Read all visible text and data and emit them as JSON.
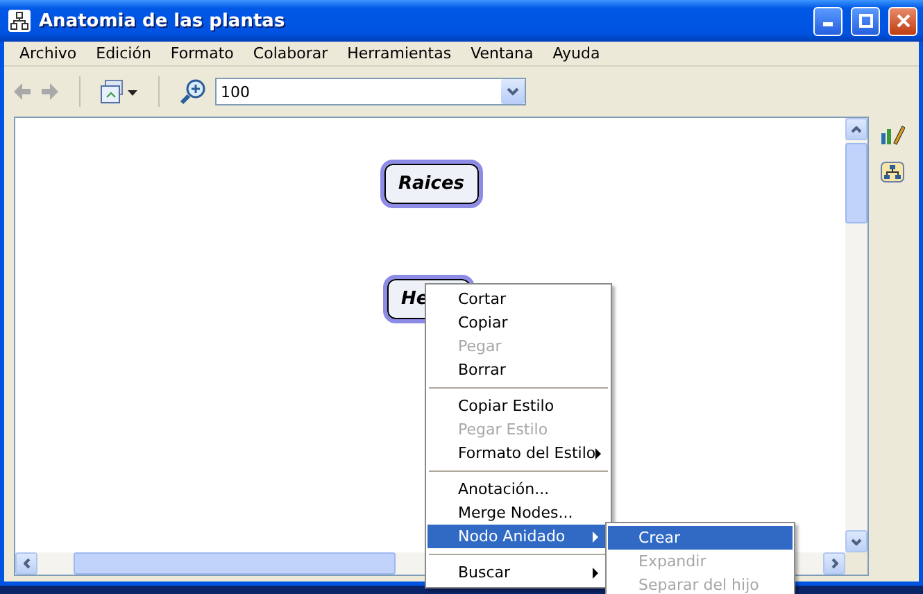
{
  "window": {
    "title": "Anatomia de las plantas"
  },
  "menu_bar": [
    "Archivo",
    "Edición",
    "Formato",
    "Colaborar",
    "Herramientas",
    "Ventana",
    "Ayuda"
  ],
  "toolbar": {
    "zoom_value": "100"
  },
  "nodes": [
    {
      "label": "Raices"
    },
    {
      "label": "He"
    }
  ],
  "context_menu": [
    {
      "kind": "item",
      "label": "Cortar",
      "disabled": false,
      "selected": false,
      "submenu": false
    },
    {
      "kind": "item",
      "label": "Copiar",
      "disabled": false,
      "selected": false,
      "submenu": false
    },
    {
      "kind": "item",
      "label": "Pegar",
      "disabled": true,
      "selected": false,
      "submenu": false
    },
    {
      "kind": "item",
      "label": "Borrar",
      "disabled": false,
      "selected": false,
      "submenu": false
    },
    {
      "kind": "separator"
    },
    {
      "kind": "item",
      "label": "Copiar Estilo",
      "disabled": false,
      "selected": false,
      "submenu": false
    },
    {
      "kind": "item",
      "label": "Pegar Estilo",
      "disabled": true,
      "selected": false,
      "submenu": false
    },
    {
      "kind": "item",
      "label": "Formato del Estilo",
      "disabled": false,
      "selected": false,
      "submenu": true
    },
    {
      "kind": "separator"
    },
    {
      "kind": "item",
      "label": "Anotación...",
      "disabled": false,
      "selected": false,
      "submenu": false
    },
    {
      "kind": "item",
      "label": "Merge Nodes...",
      "disabled": false,
      "selected": false,
      "submenu": false
    },
    {
      "kind": "item",
      "label": "Nodo Anidado",
      "disabled": false,
      "selected": true,
      "submenu": true
    },
    {
      "kind": "separator"
    },
    {
      "kind": "item",
      "label": "Buscar",
      "disabled": false,
      "selected": false,
      "submenu": true
    }
  ],
  "submenu": [
    {
      "kind": "item",
      "label": "Crear",
      "disabled": false,
      "selected": true,
      "submenu": false
    },
    {
      "kind": "item",
      "label": "Expandir",
      "disabled": true,
      "selected": false,
      "submenu": false
    },
    {
      "kind": "item",
      "label": "Separar del hijo",
      "disabled": true,
      "selected": false,
      "submenu": false
    }
  ]
}
